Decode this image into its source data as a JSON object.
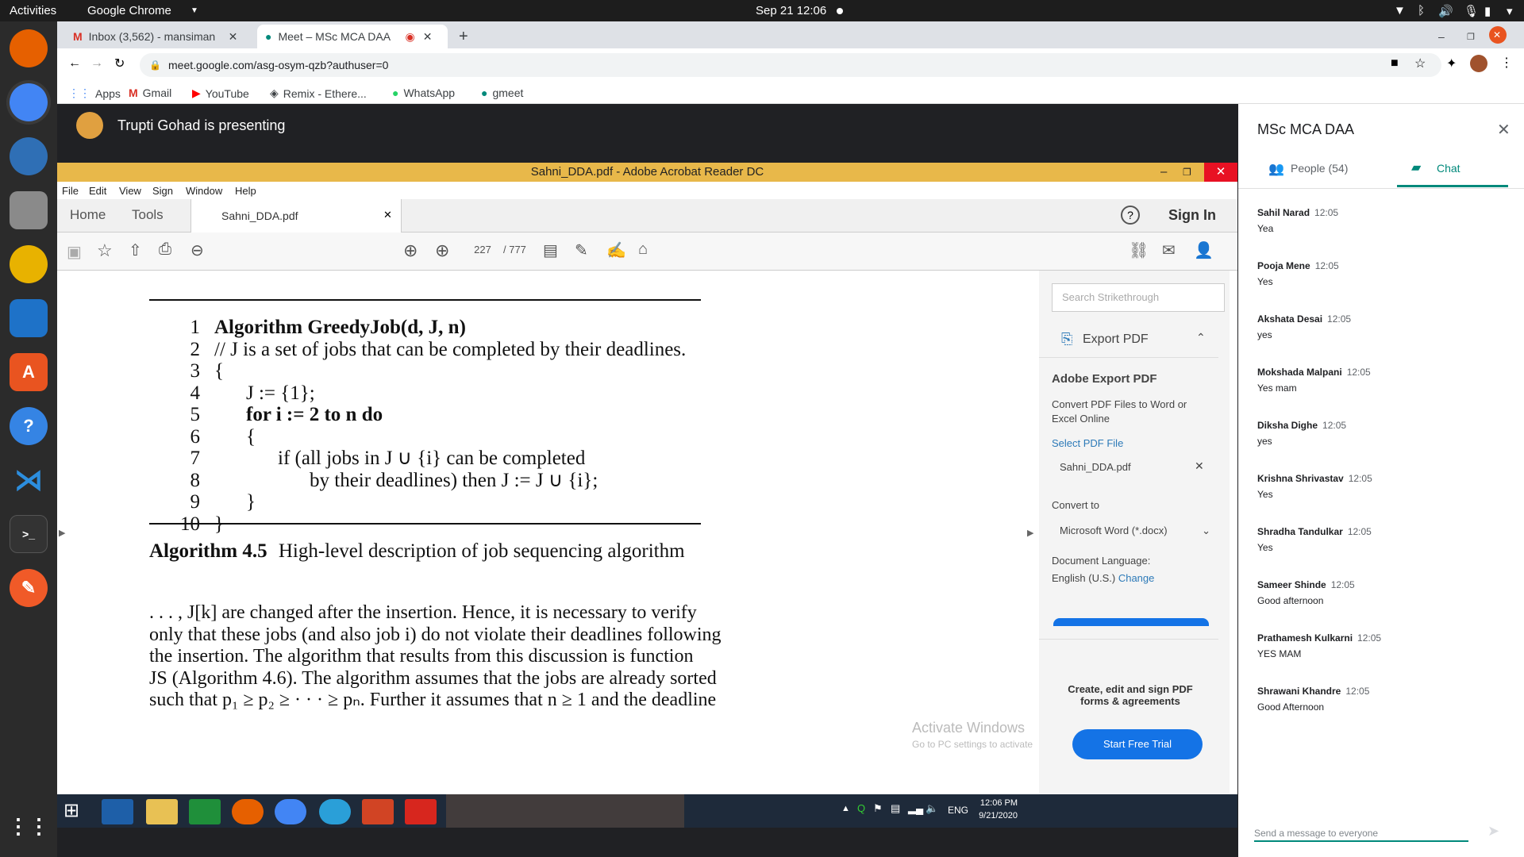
{
  "topbar": {
    "activities": "Activities",
    "app": "Google Chrome",
    "datetime": "Sep 21  12:06"
  },
  "browser": {
    "tabs": [
      {
        "label": "Inbox (3,562) - mansiman"
      },
      {
        "label": "Meet – MSc MCA DAA"
      }
    ],
    "url": "meet.google.com/asg-osym-qzb?authuser=0",
    "bookmarks": [
      {
        "label": "Apps"
      },
      {
        "label": "Gmail"
      },
      {
        "label": "YouTube"
      },
      {
        "label": "Remix - Ethere..."
      },
      {
        "label": "WhatsApp"
      },
      {
        "label": "gmeet"
      }
    ]
  },
  "meet": {
    "presenter": "Trupti Gohad is presenting"
  },
  "acrobat": {
    "title": "Sahni_DDA.pdf - Adobe Acrobat Reader DC",
    "menu": [
      "File",
      "Edit",
      "View",
      "Sign",
      "Window",
      "Help"
    ],
    "tabs": {
      "home": "Home",
      "tools": "Tools",
      "file": "Sahni_DDA.pdf"
    },
    "sign_in": "Sign In",
    "page_current": "227",
    "page_total": "/ 777"
  },
  "document": {
    "lines": [
      "Algorithm GreedyJob(d, J, n)",
      "// J is a set of jobs that can be completed by their deadlines.",
      "{",
      "J := {1};",
      "for i := 2 to n do",
      "{",
      "if (all jobs in J ∪ {i} can be completed",
      "by their deadlines) then J := J ∪ {i};",
      "}",
      "}"
    ],
    "caption_num": "Algorithm 4.5",
    "caption_text": "High-level description of job sequencing algorithm",
    "para": [
      ". . . , J[k] are changed after the insertion.  Hence, it is necessary to verify",
      "only that these jobs (and also job i) do not violate their deadlines following",
      "the insertion.  The algorithm that results from this discussion is function",
      "JS (Algorithm 4.6). The algorithm assumes that the jobs are already sorted",
      "such that p₁ ≥ p₂ ≥ · · · ≥ pₙ. Further it assumes that n ≥ 1 and the deadline"
    ]
  },
  "export_pane": {
    "search_placeholder": "Search  Strikethrough",
    "export_label": "Export PDF",
    "heading": "Adobe Export PDF",
    "desc": "Convert PDF Files to Word or Excel Online",
    "select_label": "Select PDF File",
    "file": "Sahni_DDA.pdf",
    "convert_label": "Convert to",
    "convert_value": "Microsoft Word (*.docx)",
    "lang_label": "Document Language:",
    "lang_value": "English (U.S.)",
    "lang_change": "Change",
    "promo": "Create, edit and sign PDF forms & agreements",
    "trial": "Start Free Trial",
    "watermark1": "Activate Windows",
    "watermark2": "Go to PC settings to activate"
  },
  "taskbar": {
    "lang": "ENG",
    "time": "12:06 PM",
    "date": "9/21/2020"
  },
  "panel": {
    "title": "MSc MCA DAA",
    "people_tab": "People (54)",
    "chat_tab": "Chat",
    "messages": [
      {
        "name": "Sahil Narad",
        "time": "12:05",
        "text": "Yea"
      },
      {
        "name": "Pooja Mene",
        "time": "12:05",
        "text": "Yes"
      },
      {
        "name": "Akshata Desai",
        "time": "12:05",
        "text": "yes"
      },
      {
        "name": "Mokshada Malpani",
        "time": "12:05",
        "text": "Yes mam"
      },
      {
        "name": "Diksha Dighe",
        "time": "12:05",
        "text": "yes"
      },
      {
        "name": "Krishna Shrivastav",
        "time": "12:05",
        "text": "Yes"
      },
      {
        "name": "Shradha Tandulkar",
        "time": "12:05",
        "text": "Yes"
      },
      {
        "name": "Sameer Shinde",
        "time": "12:05",
        "text": "Good afternoon"
      },
      {
        "name": "Prathamesh Kulkarni",
        "time": "12:05",
        "text": "YES MAM"
      },
      {
        "name": "Shrawani Khandre",
        "time": "12:05",
        "text": "Good Afternoon"
      }
    ],
    "input_placeholder": "Send a message to everyone"
  }
}
